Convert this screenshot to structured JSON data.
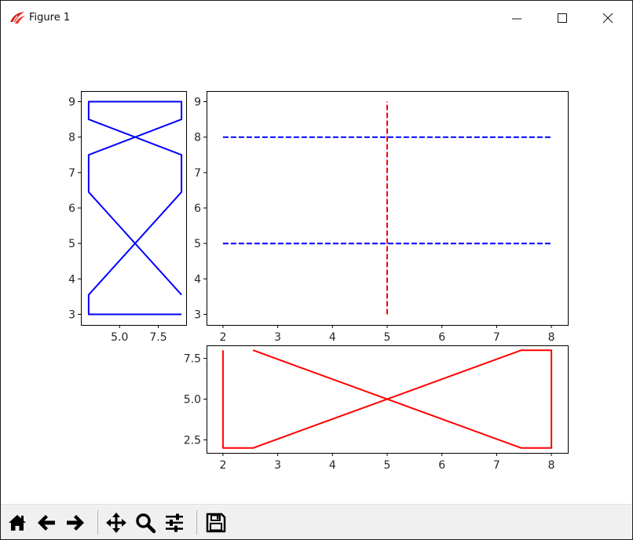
{
  "window": {
    "title": "Figure 1",
    "app_icon": "tk-feather-icon",
    "controls": [
      "minimize-icon",
      "maximize-icon",
      "close-icon"
    ]
  },
  "toolbar": {
    "buttons": [
      "home-icon",
      "back-arrow-icon",
      "forward-arrow-icon",
      "pan-icon",
      "zoom-icon",
      "configure-subplots-icon",
      "save-icon"
    ]
  },
  "chart_data": [
    {
      "type": "line",
      "panel": "left",
      "xlim": [
        2.5,
        9.3
      ],
      "ylim": [
        2.7,
        9.3
      ],
      "xticks": [
        5.0,
        7.5
      ],
      "xtick_labels": [
        "5.0",
        "7.5"
      ],
      "yticks": [
        3,
        4,
        5,
        6,
        7,
        8,
        9
      ],
      "ytick_labels": [
        "3",
        "4",
        "5",
        "6",
        "7",
        "8",
        "9"
      ],
      "grid": false,
      "series": [
        {
          "color": "#0000ff",
          "style": "solid",
          "x": [
            9,
            3,
            3,
            9,
            9,
            3,
            3,
            9,
            9,
            3,
            3,
            9
          ],
          "y": [
            3,
            3,
            3.55,
            6.45,
            7.5,
            8.5,
            9,
            9,
            8.5,
            7.5,
            6.45,
            3.55
          ]
        }
      ]
    },
    {
      "type": "line",
      "panel": "main",
      "xlim": [
        1.7,
        8.3
      ],
      "ylim": [
        2.7,
        9.3
      ],
      "xticks": [
        2,
        3,
        4,
        5,
        6,
        7,
        8
      ],
      "xtick_labels": [
        "2",
        "3",
        "4",
        "5",
        "6",
        "7",
        "8"
      ],
      "yticks": [
        3,
        4,
        5,
        6,
        7,
        8,
        9
      ],
      "ytick_labels": [
        "3",
        "4",
        "5",
        "6",
        "7",
        "8",
        "9"
      ],
      "grid": false,
      "series": [
        {
          "color": "#0000ff",
          "style": "dashed",
          "x": [
            2,
            8
          ],
          "y": [
            8,
            8
          ]
        },
        {
          "color": "#0000ff",
          "style": "dashed",
          "x": [
            2,
            8
          ],
          "y": [
            5,
            5
          ]
        },
        {
          "color": "#ff0000",
          "style": "dashed",
          "x": [
            5,
            5
          ],
          "y": [
            3,
            9
          ]
        }
      ]
    },
    {
      "type": "line",
      "panel": "bottom",
      "xlim": [
        1.7,
        8.3
      ],
      "ylim": [
        1.7,
        8.3
      ],
      "xticks": [
        2,
        3,
        4,
        5,
        6,
        7,
        8
      ],
      "xtick_labels": [
        "2",
        "3",
        "4",
        "5",
        "6",
        "7",
        "8"
      ],
      "yticks": [
        2.5,
        5.0,
        7.5
      ],
      "ytick_labels": [
        "2.5",
        "5.0",
        "7.5"
      ],
      "grid": false,
      "series": [
        {
          "color": "#ff0000",
          "style": "solid",
          "x": [
            2,
            2,
            2.55,
            7.45,
            8,
            8,
            7.45,
            2.55
          ],
          "y": [
            8,
            2,
            2,
            8,
            8,
            2,
            2,
            8
          ]
        }
      ]
    }
  ]
}
